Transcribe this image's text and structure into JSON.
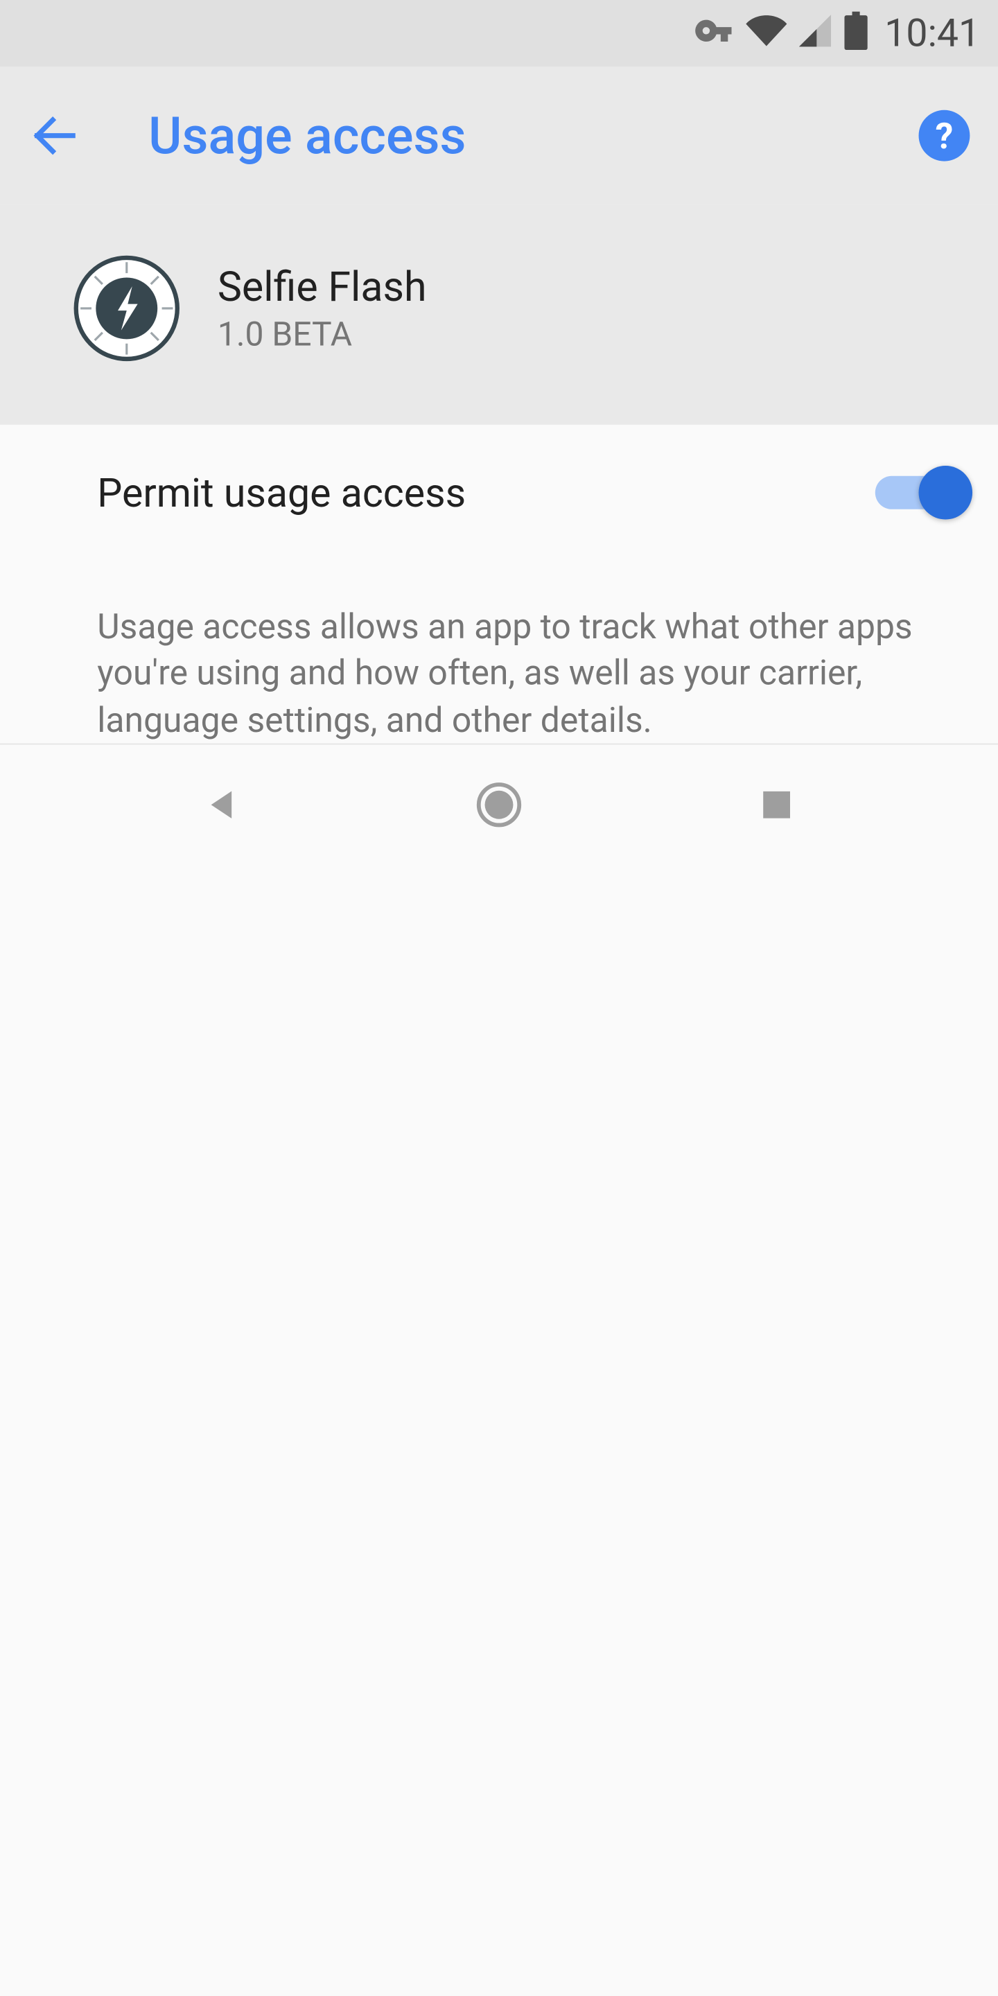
{
  "status": {
    "time": "10:41"
  },
  "header": {
    "title": "Usage access"
  },
  "app": {
    "name": "Selfie Flash",
    "version": "1.0 BETA"
  },
  "permit": {
    "label": "Permit usage access",
    "enabled": true
  },
  "description": {
    "text": "Usage access allows an app to track what other apps you're using and how often, as well as your carrier, language settings, and other details."
  }
}
